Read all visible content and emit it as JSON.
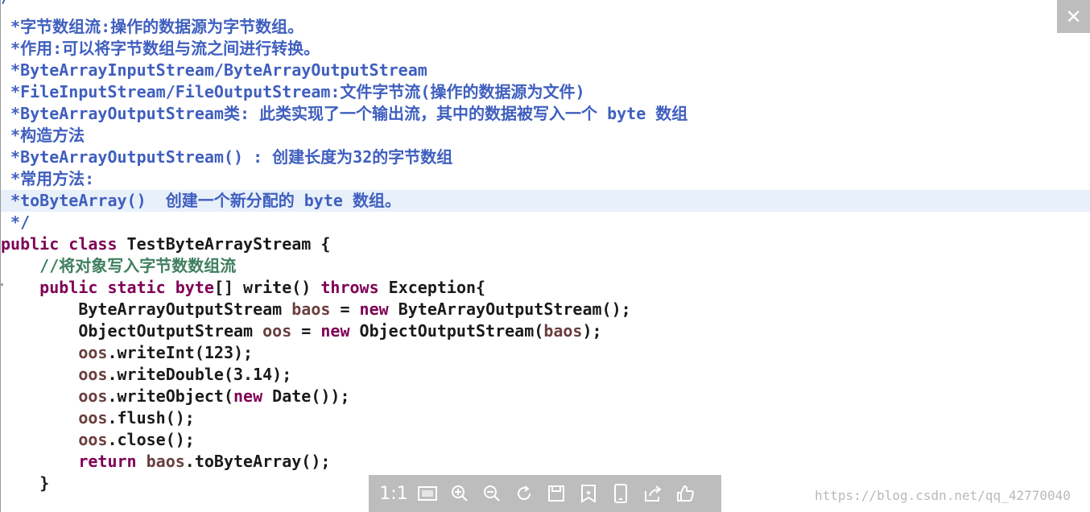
{
  "code": {
    "top_fragment": "/**",
    "doc_lines": [
      " *字节数组流:操作的数据源为字节数组。",
      " *作用:可以将字节数组与流之间进行转换。",
      " *ByteArrayInputStream/ByteArrayOutputStream",
      " *FileInputStream/FileOutputStream:文件字节流(操作的数据源为文件)",
      " *ByteArrayOutputStream类: 此类实现了一个输出流，其中的数据被写入一个 byte 数组",
      " *构造方法",
      " *ByteArrayOutputStream() : 创建长度为32的字节数组",
      " *常用方法:",
      " *toByteArray()  创建一个新分配的 byte 数组。",
      " */"
    ],
    "class_decl": {
      "kw1": "public",
      "kw2": "class",
      "name": " TestByteArrayStream {"
    },
    "comment": "    //将对象写入字节数数组流",
    "method_decl": {
      "kw1": "public",
      "kw2": "static",
      "kw3": "byte",
      "mid": "[] write() ",
      "kw4": "throws",
      "end": " Exception{"
    },
    "body": {
      "l1_type": "        ByteArrayOutputStream ",
      "l1_var": "baos",
      "l1_eq": " = ",
      "l1_new": "new",
      "l1_end": " ByteArrayOutputStream();",
      "l2_type": "        ObjectOutputStream ",
      "l2_var": "oos",
      "l2_eq": " = ",
      "l2_new": "new",
      "l2_ctor": " ObjectOutputStream(",
      "l2_arg": "baos",
      "l2_end": ");",
      "l3_var": "oos",
      "l3_end": ".writeInt(123);",
      "l4_var": "oos",
      "l4_end": ".writeDouble(3.14);",
      "l5_var": "oos",
      "l5_mid": ".writeObject(",
      "l5_new": "new",
      "l5_end": " Date());",
      "l6_var": "oos",
      "l6_end": ".flush();",
      "l7_var": "oos",
      "l7_end": ".close();",
      "l8_kw": "return",
      "l8_var": "baos",
      "l8_end": ".toByteArray();",
      "close": "    }"
    }
  },
  "viewer": {
    "close_label": "✕",
    "toolbar": {
      "ratio_label": "1:1",
      "fit_icon": "fit-screen-icon",
      "zoom_in_icon": "zoom-in-icon",
      "zoom_out_icon": "zoom-out-icon",
      "rotate_icon": "rotate-icon",
      "save_icon": "save-icon",
      "bookmark_icon": "bookmark-star-icon",
      "phone_icon": "send-to-phone-icon",
      "share_icon": "share-icon",
      "like_icon": "thumbs-up-icon"
    },
    "watermark": "https://blog.csdn.net/qq_42770040"
  },
  "colors": {
    "javadoc": "#3f5fbf",
    "keyword": "#7f0055",
    "comment": "#3f7f5f",
    "variable": "#6a3e3e",
    "highlight_line": "#e8f0fa"
  }
}
